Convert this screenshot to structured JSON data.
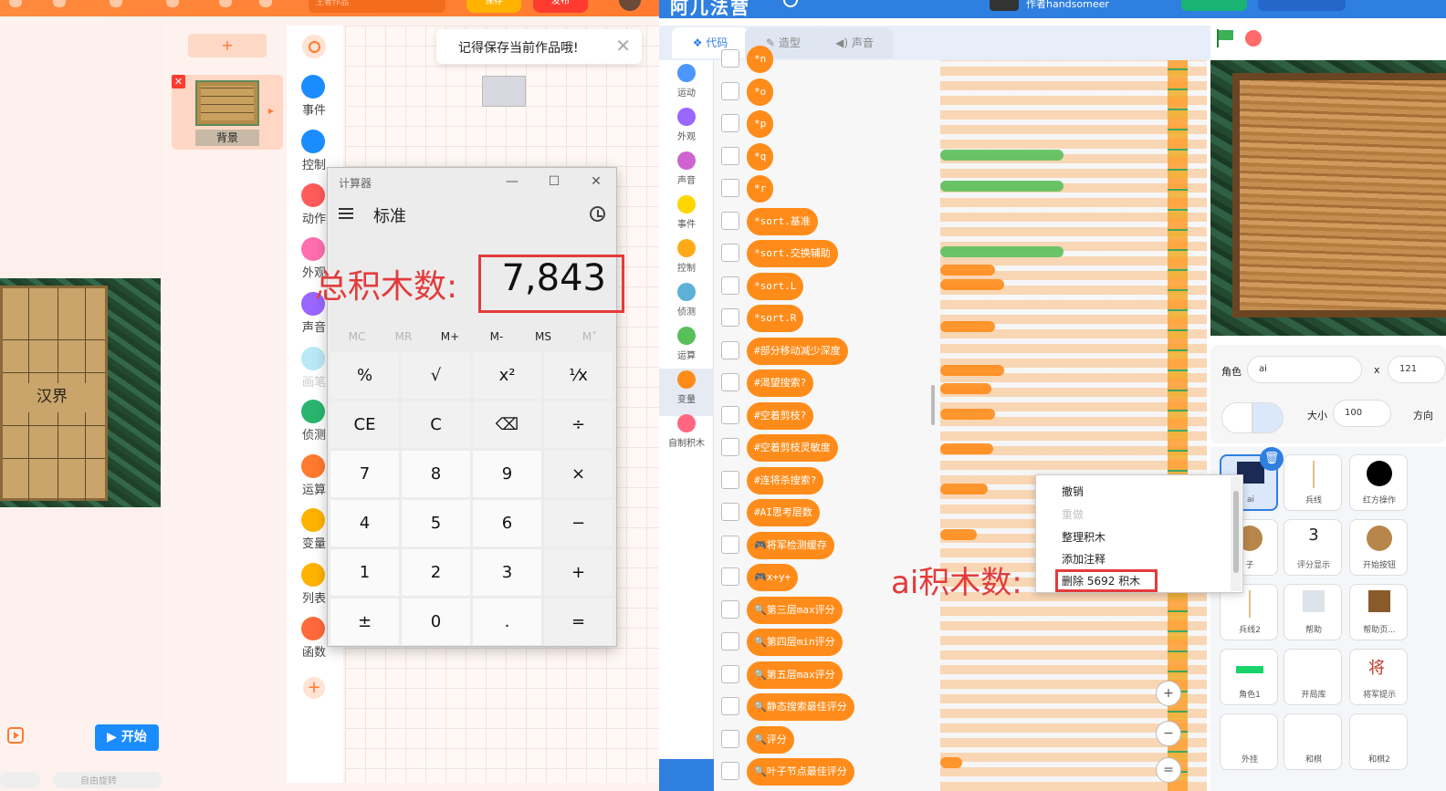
{
  "left_app": {
    "title_input": "王者作品",
    "save_label": "保存",
    "publish_label": "发布",
    "add_sprite": "+",
    "background_label": "背景",
    "stage_board_text": "汉界",
    "start_label": "▶ 开始",
    "auto_rotate_label": "自由旋转",
    "save_reminder": "记得保存当前作品哦!",
    "categories": [
      "事件",
      "控制",
      "动作",
      "外观",
      "声音",
      "画笔",
      "侦测",
      "运算",
      "变量",
      "列表",
      "函数"
    ]
  },
  "calculator": {
    "window_title": "计算器",
    "mode": "标准",
    "display": "7,843",
    "memory_buttons": [
      "MC",
      "MR",
      "M+",
      "M-",
      "MS",
      "M˅"
    ],
    "keys": [
      [
        "%",
        "√",
        "x²",
        "¹⁄x"
      ],
      [
        "CE",
        "C",
        "⌫",
        "÷"
      ],
      [
        "7",
        "8",
        "9",
        "×"
      ],
      [
        "4",
        "5",
        "6",
        "−"
      ],
      [
        "1",
        "2",
        "3",
        "+"
      ],
      [
        "±",
        "0",
        ".",
        "="
      ]
    ]
  },
  "annotations": {
    "total_blocks_label": "总积木数:",
    "ai_blocks_label": "ai积木数:"
  },
  "right_app": {
    "author_label": "作者handsomeer",
    "tabs": [
      "代码",
      "造型",
      "声音"
    ],
    "categories": [
      "运动",
      "外观",
      "声音",
      "事件",
      "控制",
      "侦测",
      "运算",
      "变量",
      "自制积木"
    ],
    "category_colors": [
      "#4c97ff",
      "#9966ff",
      "#cf63cf",
      "#ffd500",
      "#ffab19",
      "#5cb1d6",
      "#59c059",
      "#ff8c1a",
      "#ff6680"
    ],
    "palette_blocks": [
      "*n",
      "*o",
      "*p",
      "*q",
      "*r",
      "*sort.基准",
      "*sort.交换辅助",
      "*sort.L",
      "*sort.R",
      "#部分移动减少深度",
      "#渴望搜索?",
      "#空着剪枝?",
      "#空着剪枝灵敏度",
      "#连将杀搜索?",
      "#AI思考层数",
      "🎮将军检测缓存",
      "🎮x+y+",
      "🔍第三层max评分",
      "🔍第四层min评分",
      "🔍第五层max评分",
      "🔍静态搜索最佳评分",
      "🔍评分",
      "🔍叶子节点最佳评分"
    ],
    "context_menu": {
      "undo": "撤销",
      "redo": "重做",
      "clean_up": "整理积木",
      "add_comment": "添加注释",
      "delete": "删除 5692 积木"
    },
    "sprite_info": {
      "sprite_label": "角色",
      "sprite_name": "ai",
      "x_label": "x",
      "x_value": "121",
      "size_label": "大小",
      "size_value": "100",
      "direction_label": "方向"
    },
    "sprites": [
      "ai",
      "兵线",
      "红方操作",
      "子",
      "评分显示",
      "开始按钮",
      "兵线2",
      "帮助",
      "帮助页...",
      "角色1",
      "开局库",
      "将军提示",
      "外挂",
      "和棋",
      "和棋2"
    ],
    "score_display_value": "3",
    "general_glyph": "将"
  }
}
